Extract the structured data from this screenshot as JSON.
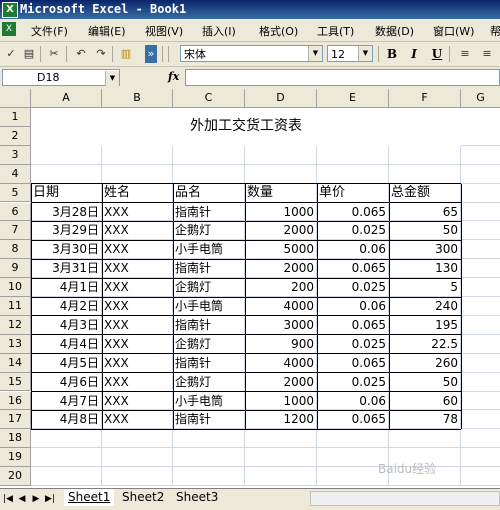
{
  "window": {
    "title": "Microsoft Excel - Book1"
  },
  "menu": [
    "文件(F)",
    "编辑(E)",
    "视图(V)",
    "插入(I)",
    "格式(O)",
    "工具(T)",
    "数据(D)",
    "窗口(W)",
    "帮"
  ],
  "toolbar": {
    "font_name": "宋体",
    "font_size": "12",
    "bold": "B",
    "italic": "I",
    "underline": "U"
  },
  "formula_bar": {
    "name_box": "D18",
    "fx": "fx",
    "formula": ""
  },
  "columns": [
    "A",
    "B",
    "C",
    "D",
    "E",
    "F",
    "G"
  ],
  "rows": [
    "1",
    "2",
    "3",
    "4",
    "5",
    "6",
    "7",
    "8",
    "9",
    "10",
    "11",
    "12",
    "13",
    "14",
    "15",
    "16",
    "17",
    "18",
    "19",
    "20"
  ],
  "sheet_title": "外加工交货工资表",
  "table": {
    "headers": [
      "日期",
      "姓名",
      "品名",
      "数量",
      "单价",
      "总金额"
    ],
    "rows": [
      [
        "3月28日",
        "XXX",
        "指南针",
        "1000",
        "0.065",
        "65"
      ],
      [
        "3月29日",
        "XXX",
        "企鹅灯",
        "2000",
        "0.025",
        "50"
      ],
      [
        "3月30日",
        "XXX",
        "小手电筒",
        "5000",
        "0.06",
        "300"
      ],
      [
        "3月31日",
        "XXX",
        "指南针",
        "2000",
        "0.065",
        "130"
      ],
      [
        "4月1日",
        "XXX",
        "企鹅灯",
        "200",
        "0.025",
        "5"
      ],
      [
        "4月2日",
        "XXX",
        "小手电筒",
        "4000",
        "0.06",
        "240"
      ],
      [
        "4月3日",
        "XXX",
        "指南针",
        "3000",
        "0.065",
        "195"
      ],
      [
        "4月4日",
        "XXX",
        "企鹅灯",
        "900",
        "0.025",
        "22.5"
      ],
      [
        "4月5日",
        "XXX",
        "指南针",
        "4000",
        "0.065",
        "260"
      ],
      [
        "4月6日",
        "XXX",
        "企鹅灯",
        "2000",
        "0.025",
        "50"
      ],
      [
        "4月7日",
        "XXX",
        "小手电筒",
        "1000",
        "0.06",
        "60"
      ],
      [
        "4月8日",
        "XXX",
        "指南针",
        "1200",
        "0.065",
        "78"
      ]
    ]
  },
  "sheet_tabs": [
    "Sheet1",
    "Sheet2",
    "Sheet3"
  ],
  "active_sheet": "Sheet1",
  "watermark": "Baidu经验"
}
